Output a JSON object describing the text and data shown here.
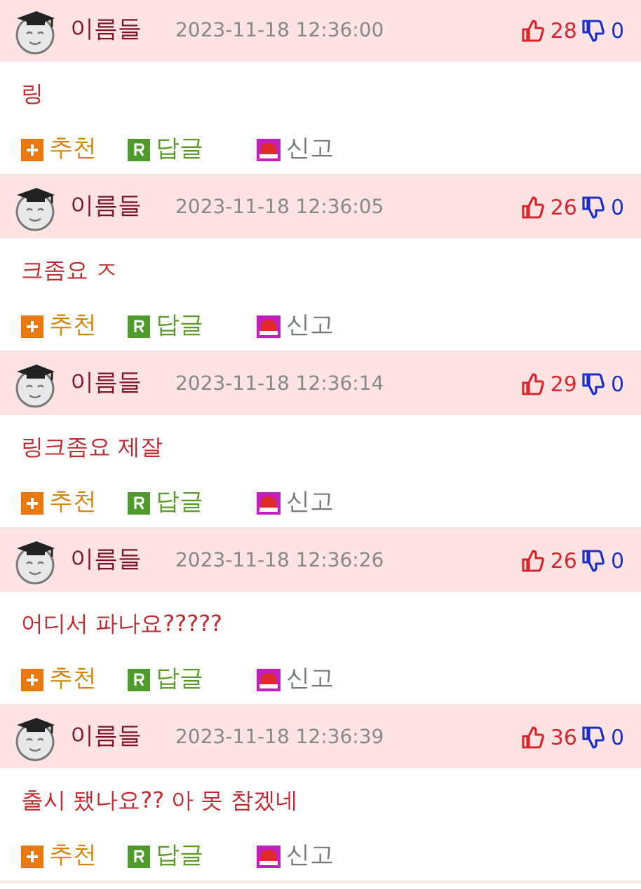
{
  "comments": [
    {
      "author": "이름들",
      "date": "2023-11-18 12:36:00",
      "likes": "28",
      "dislikes": "0",
      "text": "링",
      "actions": [
        "추천",
        "답글",
        "신고"
      ]
    },
    {
      "author": "이름들",
      "date": "2023-11-18 12:36:05",
      "likes": "26",
      "dislikes": "0",
      "text": "크좀요 ㅈ",
      "actions": [
        "추천",
        "답글",
        "신고"
      ]
    },
    {
      "author": "이름들",
      "date": "2023-11-18 12:36:14",
      "likes": "29",
      "dislikes": "0",
      "text": "링크좀요 제잘",
      "actions": [
        "추천",
        "답글",
        "신고"
      ]
    },
    {
      "author": "이름들",
      "date": "2023-11-18 12:36:26",
      "likes": "26",
      "dislikes": "0",
      "text": "어디서 파나요?????",
      "actions": [
        "추천",
        "답글",
        "신고"
      ]
    },
    {
      "author": "이름들",
      "date": "2023-11-18 12:36:39",
      "likes": "36",
      "dislikes": "0",
      "text": "출시 됐나요?? 아 못 참겠네",
      "actions": [
        "추천",
        "답글",
        "신고"
      ]
    }
  ]
}
